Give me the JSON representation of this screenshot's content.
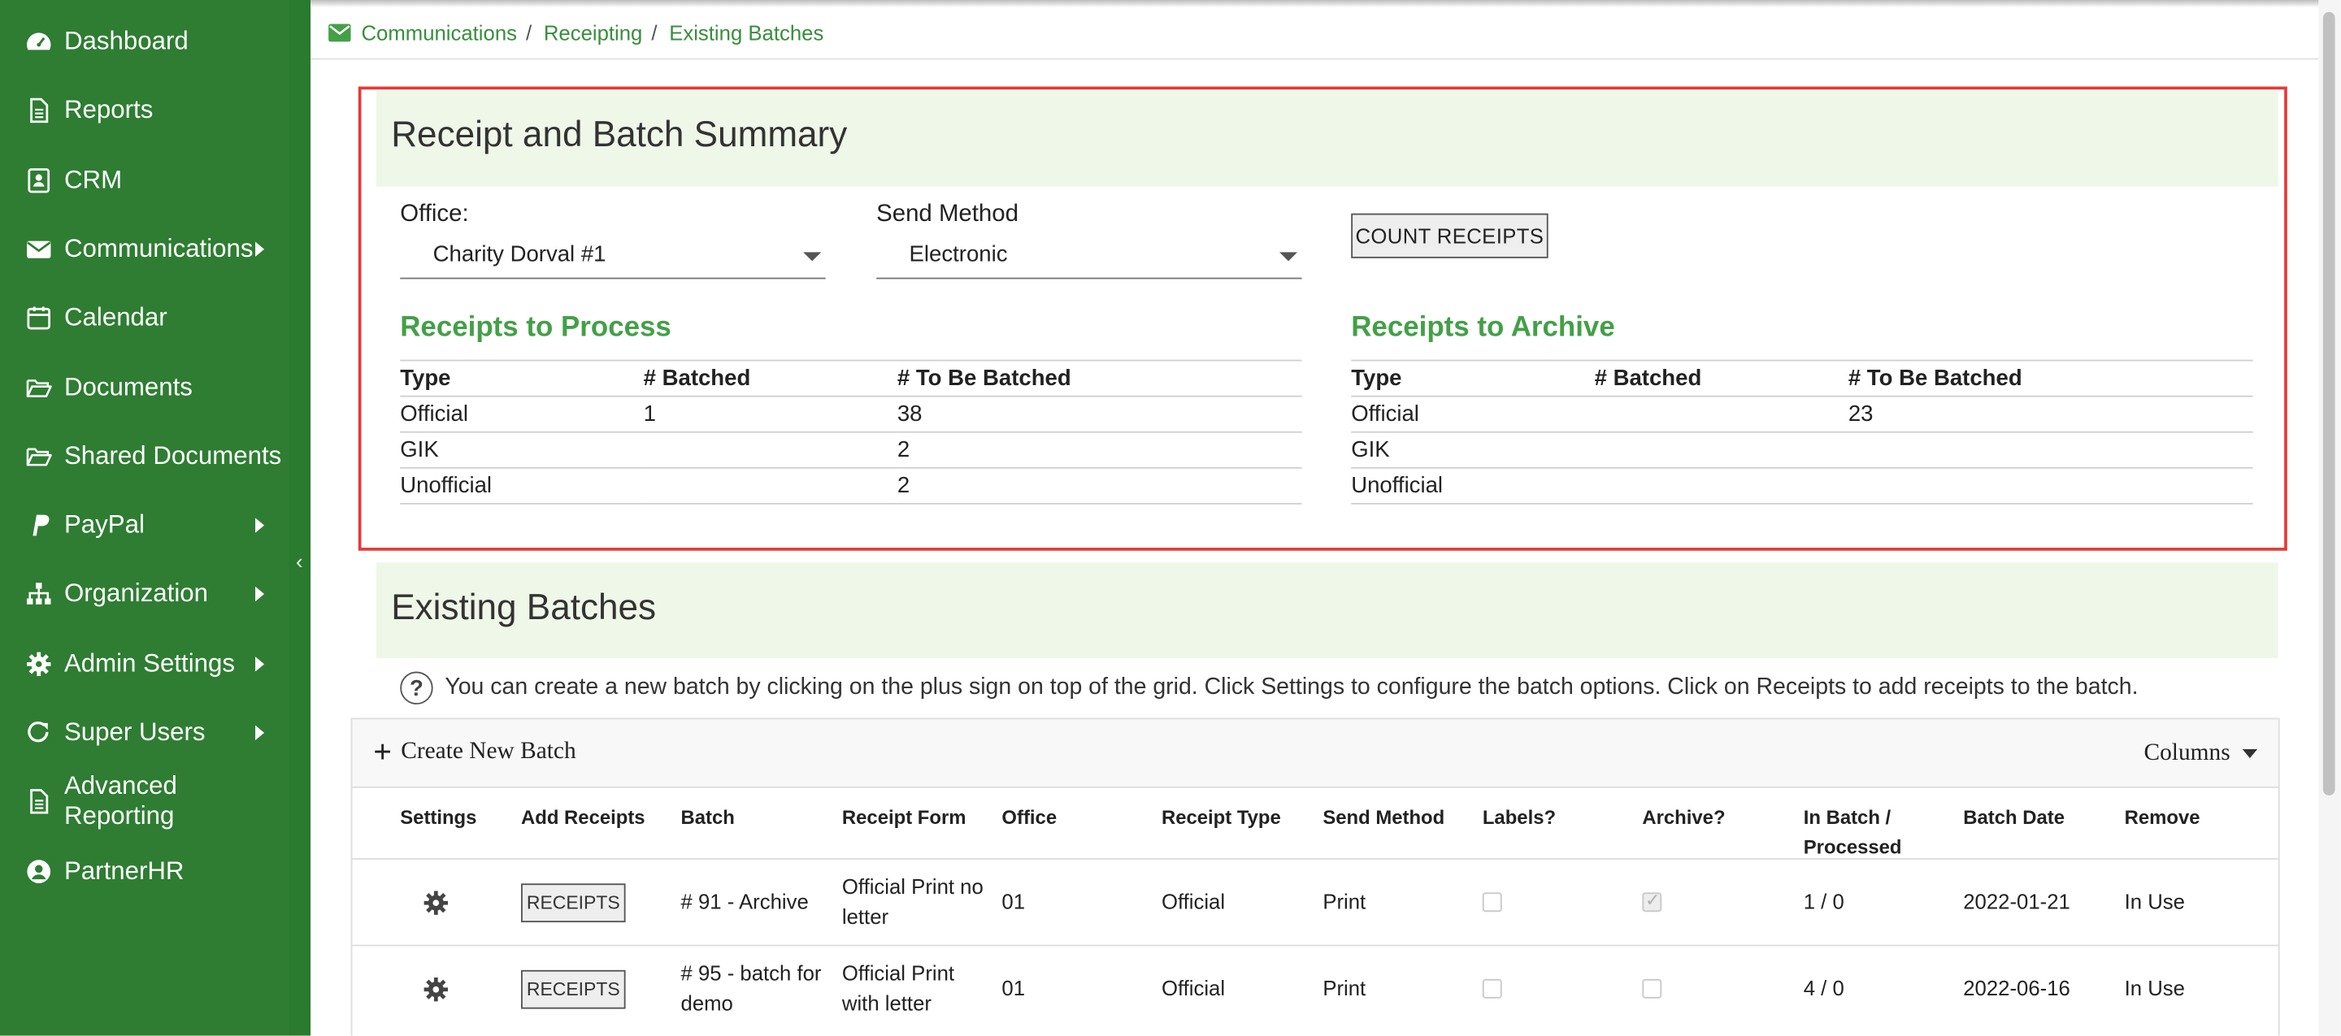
{
  "sidebar": {
    "items": [
      {
        "label": "Dashboard",
        "icon": "dashboard-icon"
      },
      {
        "label": "Reports",
        "icon": "file-icon"
      },
      {
        "label": "CRM",
        "icon": "contact-card-icon"
      },
      {
        "label": "Communications",
        "icon": "envelope-icon",
        "has_submenu": true
      },
      {
        "label": "Calendar",
        "icon": "calendar-icon"
      },
      {
        "label": "Documents",
        "icon": "folder-open-icon"
      },
      {
        "label": "Shared Documents",
        "icon": "folder-open-icon"
      },
      {
        "label": "PayPal",
        "icon": "paypal-icon",
        "has_submenu": true
      },
      {
        "label": "Organization",
        "icon": "sitemap-icon",
        "has_submenu": true
      },
      {
        "label": "Admin Settings",
        "icon": "gear-icon",
        "has_submenu": true
      },
      {
        "label": "Super Users",
        "icon": "refresh-icon",
        "has_submenu": true
      },
      {
        "label": "Advanced Reporting",
        "icon": "file-icon"
      },
      {
        "label": "PartnerHR",
        "icon": "user-circle-icon"
      }
    ],
    "collapse_glyph": "‹"
  },
  "breadcrumb": {
    "items": [
      "Communications",
      "Receipting",
      "Existing Batches"
    ],
    "separator": "/"
  },
  "summary": {
    "title": "Receipt and Batch Summary",
    "office_label": "Office:",
    "office_value": "Charity Dorval #1",
    "send_method_label": "Send Method",
    "send_method_value": "Electronic",
    "count_button": "COUNT RECEIPTS",
    "process": {
      "title": "Receipts to Process",
      "headers": [
        "Type",
        "# Batched",
        "# To Be Batched"
      ],
      "rows": [
        [
          "Official",
          "1",
          "38"
        ],
        [
          "GIK",
          "",
          "2"
        ],
        [
          "Unofficial",
          "",
          "2"
        ]
      ]
    },
    "archive": {
      "title": "Receipts to Archive",
      "headers": [
        "Type",
        "# Batched",
        "# To Be Batched"
      ],
      "rows": [
        [
          "Official",
          "",
          "23"
        ],
        [
          "GIK",
          "",
          ""
        ],
        [
          "Unofficial",
          "",
          ""
        ]
      ]
    }
  },
  "batches": {
    "title": "Existing Batches",
    "help_text": "You can create a new batch by clicking on the plus sign on top of the grid. Click Settings to configure the batch options. Click on Receipts to add receipts to the batch.",
    "create_label": "Create New Batch",
    "columns_label": "Columns",
    "headers": [
      "Settings",
      "Add Receipts",
      "Batch",
      "Receipt Form",
      "Office",
      "Receipt Type",
      "Send Method",
      "Labels?",
      "Archive?",
      "In Batch /\nProcessed",
      "Batch Date",
      "Remove"
    ],
    "header_inbatch_1": "In Batch /",
    "header_inbatch_2": "Processed",
    "receipts_button": "RECEIPTS",
    "rows": [
      {
        "batch_1": "# 91 - Archive",
        "batch_2": "",
        "form_1": "Official Print no",
        "form_2": "letter",
        "office": "01",
        "type": "Official",
        "send_method": "Print",
        "labels": false,
        "archive": true,
        "in_batch": "1 / 0",
        "date": "2022-01-21",
        "remove": "In Use"
      },
      {
        "batch_1": "# 95 - batch for",
        "batch_2": "demo",
        "form_1": "Official Print",
        "form_2": "with letter",
        "office": "01",
        "type": "Official",
        "send_method": "Print",
        "labels": false,
        "archive": false,
        "in_batch": "4 / 0",
        "date": "2022-06-16",
        "remove": "In Use"
      }
    ]
  },
  "colors": {
    "sidebar": "#2e7d32",
    "accent": "#43a047",
    "highlight_border": "#e53935",
    "panel_header": "#eef7e8"
  }
}
